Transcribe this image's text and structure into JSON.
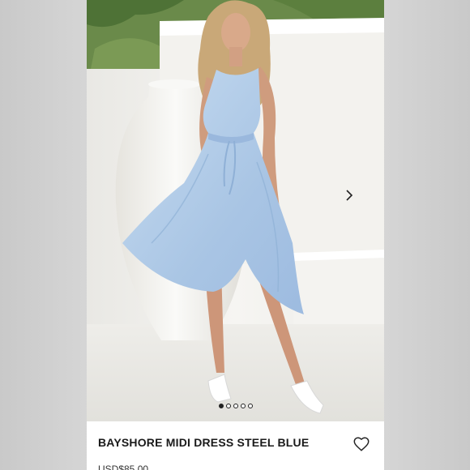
{
  "product": {
    "title": "BAYSHORE MIDI DRESS STEEL BLUE",
    "price": "USD$85.00"
  },
  "gallery": {
    "image_alt": "Model wearing steel blue midi dress beside large white vase",
    "current_index": 1,
    "total": 5,
    "next_icon": "chevron-right-icon"
  },
  "icons": {
    "favorite": "heart-outline-icon"
  },
  "colors": {
    "dress": "#b7cfe9",
    "background": "#ffffff",
    "text": "#1a1a1a"
  }
}
